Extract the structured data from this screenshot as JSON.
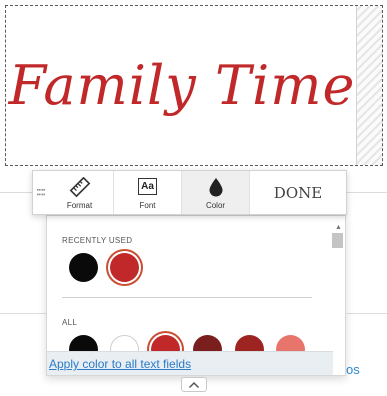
{
  "canvas": {
    "text": "Family Time",
    "text_color": "#c0282a"
  },
  "toolbar": {
    "tabs": [
      {
        "label": "Format",
        "icon": "ruler-icon"
      },
      {
        "label": "Font",
        "icon": "font-aa-icon"
      },
      {
        "label": "Color",
        "icon": "droplet-icon",
        "active": true
      }
    ],
    "done_label": "DONE"
  },
  "color_panel": {
    "recently_used_label": "RECENTLY USED",
    "all_label": "ALL",
    "recent_colors": [
      "#0a0a0a",
      "#c0282a"
    ],
    "recent_selected": "#c0282a",
    "all_colors": [
      "#0a0a0a",
      "#ffffff",
      "#c0282a",
      "#7a1f1d",
      "#9e2421",
      "#e8756b"
    ],
    "all_selected": "#c0282a",
    "apply_all_label": "Apply color to all text fields"
  },
  "background": {
    "fragment_text": "os"
  }
}
